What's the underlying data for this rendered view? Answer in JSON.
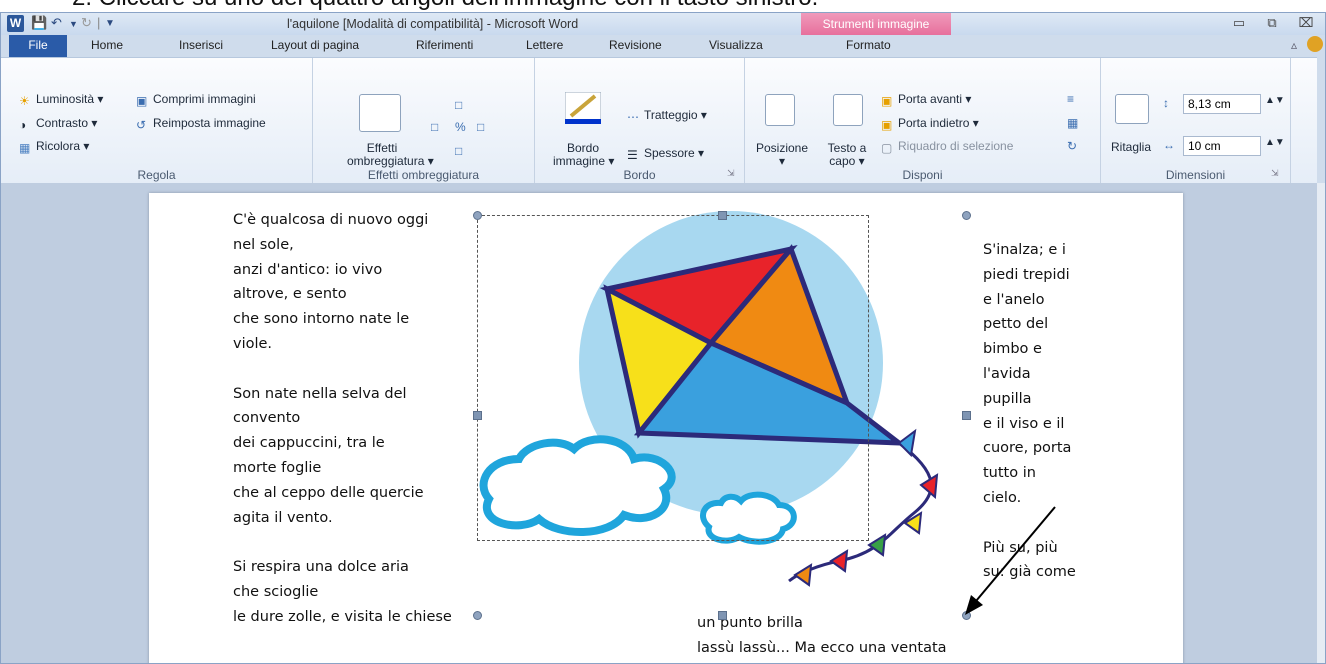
{
  "caption": "2. Cliccare su uno dei quattro angoli dell'immagine con il tasto sinistro.",
  "window": {
    "title": "l'aquilone [Modalità di compatibilità] - Microsoft Word",
    "contextual_group": "Strumenti immagine"
  },
  "tabs": {
    "file": "File",
    "items": [
      "Home",
      "Inserisci",
      "Layout di pagina",
      "Riferimenti",
      "Lettere",
      "Revisione",
      "Visualizza",
      "Formato"
    ]
  },
  "ribbon": {
    "regola": {
      "luminosita": "Luminosità",
      "contrasto": "Contrasto",
      "ricolora": "Ricolora",
      "comprimi": "Comprimi immagini",
      "reimposta": "Reimposta immagine",
      "label": "Regola"
    },
    "effetti": {
      "btn_line1": "Effetti",
      "btn_line2": "ombreggiatura",
      "label": "Effetti ombreggiatura"
    },
    "bordo": {
      "btn_line1": "Bordo",
      "btn_line2": "immagine",
      "tratteggio": "Tratteggio",
      "spessore": "Spessore",
      "label": "Bordo"
    },
    "disponi": {
      "posizione": "Posizione",
      "testo_line1": "Testo a",
      "testo_line2": "capo",
      "porta_avanti": "Porta avanti",
      "porta_indietro": "Porta indietro",
      "riquadro": "Riquadro di selezione",
      "label": "Disponi"
    },
    "dimensioni": {
      "ritaglia": "Ritaglia",
      "altezza": "8,13 cm",
      "larghezza": "10 cm",
      "label": "Dimensioni"
    }
  },
  "document": {
    "left_col": "C'è qualcosa di nuovo oggi\nnel sole,\nanzi d'antico: io vivo\naltrove, e sento\nche sono intorno nate le\nviole.\n\nSon nate nella selva del\nconvento\ndei cappuccini, tra le\nmorte foglie\nche al ceppo delle quercie\nagita il vento.\n\nSi respira una dolce aria\nche scioglie\nle dure zolle, e visita le chiese",
    "right_col": "S'inalza; e i\npiedi trepidi\ne l'anelo\npetto del\nbimbo e\nl'avida\npupilla\ne il viso e il\ncuore, porta\ntutto in\ncielo.\n\nPiù su, più\nsu: già come",
    "bottom_col": "un punto brilla\nlassù lassù... Ma ecco una ventata"
  },
  "colors": {
    "file_tab": "#2a5ba8",
    "context_tab": "#e76f9c",
    "kite_red": "#e8232a",
    "kite_orange": "#f08a12",
    "kite_yellow": "#f7e01a",
    "kite_blue": "#3aa0de",
    "kite_outline": "#2c2a7a",
    "sky_circle": "#a8d8f0",
    "cloud_outline": "#1fa5dc"
  }
}
